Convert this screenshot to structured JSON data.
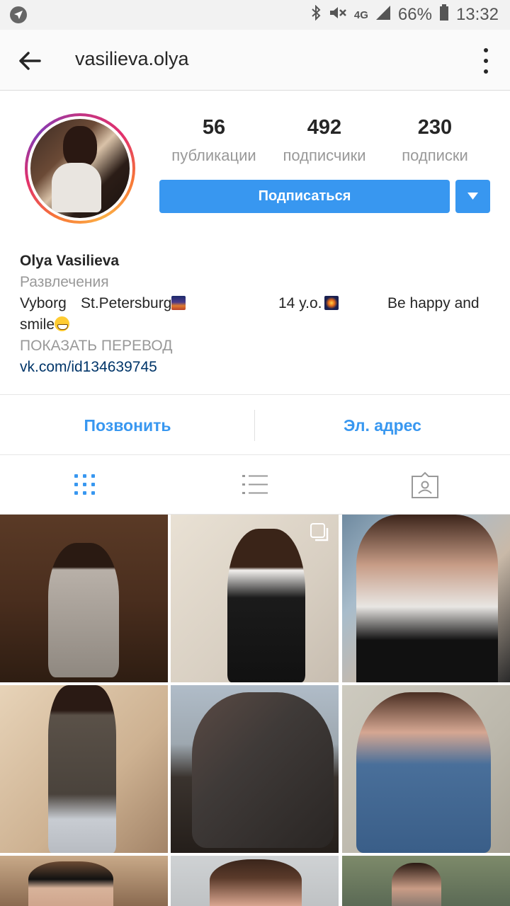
{
  "status_bar": {
    "battery": "66%",
    "time": "13:32",
    "network": "4G",
    "icons": [
      "navigation-icon",
      "bluetooth-icon",
      "mute-icon",
      "signal-icon",
      "battery-icon"
    ]
  },
  "header": {
    "username": "vasilieva.olya",
    "icons": [
      "back-arrow-icon",
      "more-vertical-icon"
    ]
  },
  "profile": {
    "stats": [
      {
        "value": "56",
        "label": "публикации"
      },
      {
        "value": "492",
        "label": "подписчики"
      },
      {
        "value": "230",
        "label": "подписки"
      }
    ],
    "follow_label": "Подписаться"
  },
  "bio": {
    "name": "Olya Vasilieva",
    "category": "Развлечения",
    "line1_part1": "Vyborg",
    "line1_part2": "St.Petersburg",
    "line1_part3": "14 y.o.",
    "line1_part4": "Be happy and",
    "line2": "smile",
    "translate": "ПОКАЗАТЬ ПЕРЕВОД",
    "link": "vk.com/id134639745"
  },
  "contact": {
    "call_label": "Позвонить",
    "email_label": "Эл. адрес"
  },
  "tabs": [
    "grid-view-icon",
    "list-view-icon",
    "tagged-photos-icon"
  ],
  "colors": {
    "accent": "#3897f0",
    "link": "#003569",
    "muted": "#999999"
  }
}
